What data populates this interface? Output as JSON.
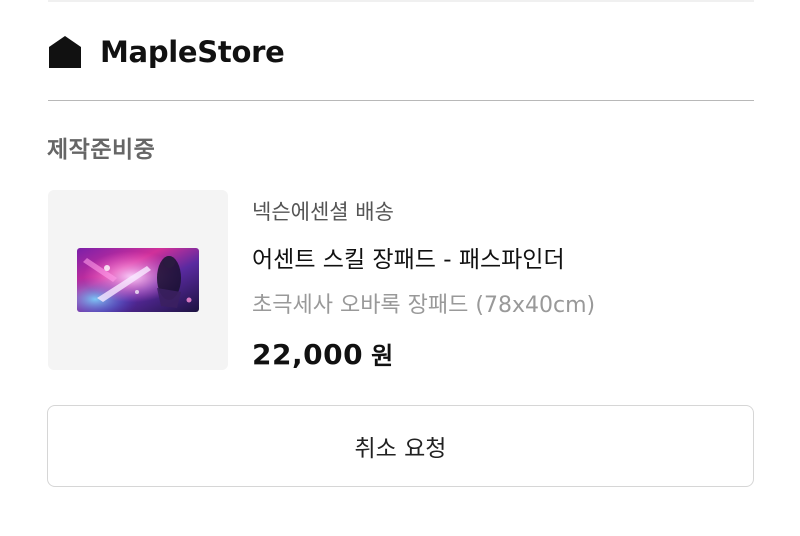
{
  "header": {
    "icon": "home-icon",
    "store_name": "MapleStore"
  },
  "order": {
    "status": "제작준비중",
    "item": {
      "thumbnail_icon": "mousepad-image",
      "shipping": "넥슨에센셜 배송",
      "name": "어센트 스킬 장패드 - 패스파인더",
      "option": "초극세사 오바록 장패드 (78x40cm)",
      "price": "22,000",
      "currency": "원"
    }
  },
  "actions": {
    "cancel_label": "취소 요청"
  },
  "colors": {
    "status_text": "#666666",
    "option_text": "#999999",
    "divider": "#b8b8b8",
    "button_border": "#d6d6d6"
  }
}
